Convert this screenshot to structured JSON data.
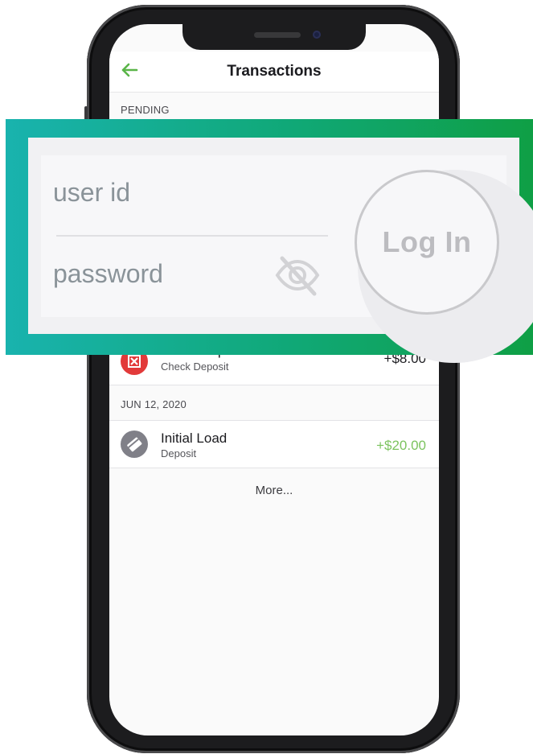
{
  "navbar": {
    "back_icon": "arrow-left-icon",
    "title": "Transactions"
  },
  "sections": {
    "pending": "PENDING",
    "date": "JUN 12, 2020"
  },
  "transactions": [
    {
      "title": "Photo Deposit",
      "subtitle": "Check Deposit",
      "amount": "+$8.00",
      "icon": "rejected-x-icon",
      "amount_color": "#1b1b1f"
    },
    {
      "title": "Initial Load",
      "subtitle": "Deposit",
      "amount": "+$20.00",
      "icon": "card-deposit-icon",
      "amount_color": "#7cc35f"
    }
  ],
  "more_label": "More...",
  "login": {
    "user_id_placeholder": "user id",
    "password_placeholder": "password",
    "visibility_icon": "eye-off-icon",
    "button_label": "Log In"
  },
  "colors": {
    "accent_green": "#5ab548",
    "overlay_start": "#19b3ae",
    "overlay_end": "#0f9f45",
    "reject_red": "#e23a3a"
  }
}
